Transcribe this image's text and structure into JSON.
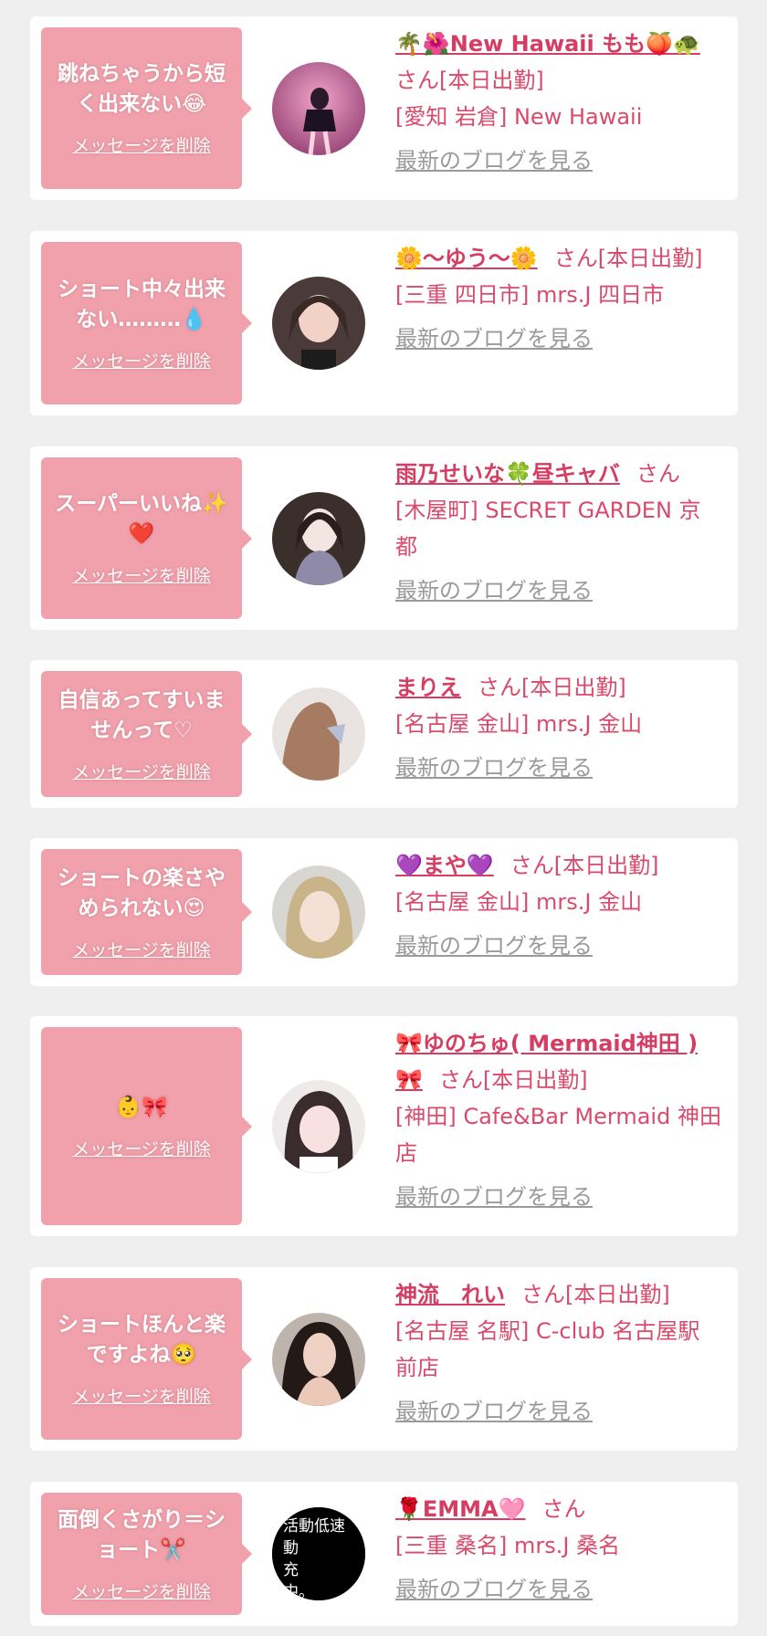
{
  "delete_label": "メッセージを削除",
  "blog_label": "最新のブログを見る",
  "colors": {
    "bubble": "#f0a1ac",
    "name": "#d53d63",
    "text": "#d94a6c",
    "link_gray": "#9a9a9a",
    "background": "#f0efef"
  },
  "items": [
    {
      "message": "跳ねちゃうから短く出来ない😂",
      "name": "🌴🌺New Hawaii もも🍑🐢",
      "suffix": "さん[本日出勤]",
      "shop": "[愛知 岩倉] New Hawaii"
    },
    {
      "message": "ショート中々出来ない………💧",
      "name": "🌼～ゆう～🌼",
      "suffix": "さん[本日出勤]",
      "shop": "[三重 四日市] mrs.J 四日市"
    },
    {
      "message": "スーパーいいね✨❤️",
      "name": "雨乃せいな🍀昼キャバ",
      "suffix": "さん",
      "shop": "[木屋町] SECRET GARDEN 京都"
    },
    {
      "message": "自信あってすいませんって♡",
      "name": "まりえ",
      "suffix": "さん[本日出勤]",
      "shop": "[名古屋 金山] mrs.J 金山"
    },
    {
      "message": "ショートの楽さやめられない😍",
      "name": "💜まや💜",
      "suffix": "さん[本日出勤]",
      "shop": "[名古屋 金山] mrs.J 金山"
    },
    {
      "message": "👶🎀",
      "name": "🎀ゆのちゅ( Mermaid神田 )🎀",
      "suffix": "さん[本日出勤]",
      "shop": "[神田] Cafe&Bar Mermaid 神田店"
    },
    {
      "message": "ショートほんと楽ですよね🥺",
      "name": "神流　れい",
      "suffix": "さん[本日出勤]",
      "shop": "[名古屋 名駅] C-club 名古屋駅前店"
    },
    {
      "message": "面倒くさがり＝ショート✂️",
      "name": "🌹EMMA🩷",
      "suffix": "さん",
      "shop": "[三重 桑名] mrs.J 桑名",
      "avatar_text": "活動低速中。\n動\n充\n中"
    }
  ]
}
